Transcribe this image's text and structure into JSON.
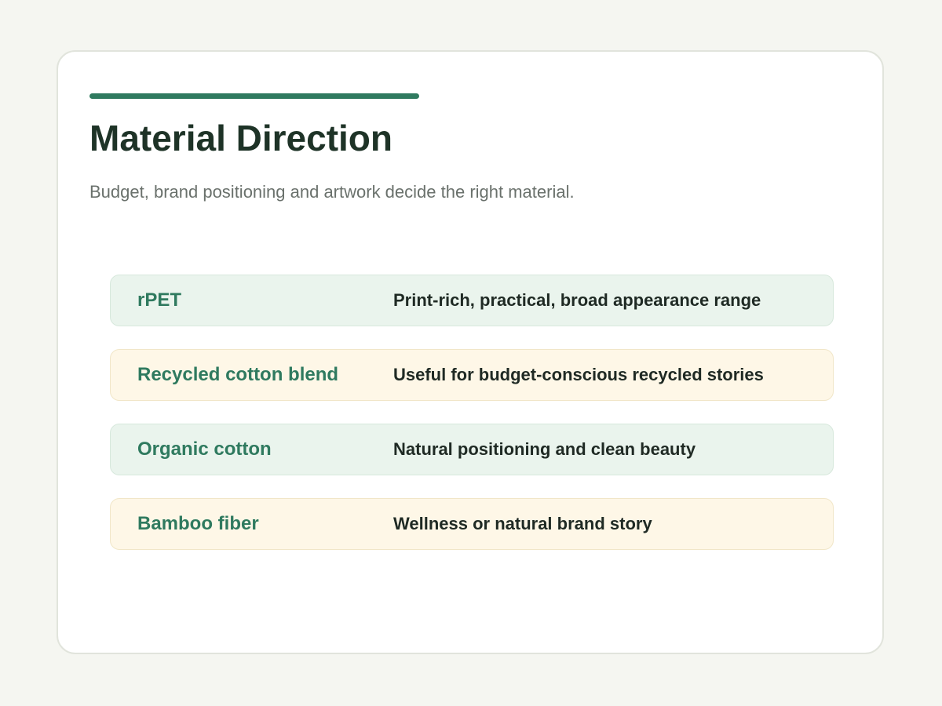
{
  "header": {
    "title": "Material Direction",
    "subtitle": "Budget, brand positioning and artwork decide the right material."
  },
  "materials": [
    {
      "name": "rPET",
      "description": "Print-rich, practical, broad appearance range",
      "tone": "green"
    },
    {
      "name": "Recycled cotton blend",
      "description": "Useful for budget-conscious recycled stories",
      "tone": "cream"
    },
    {
      "name": "Organic cotton",
      "description": "Natural positioning and clean beauty",
      "tone": "green"
    },
    {
      "name": "Bamboo fiber",
      "description": "Wellness or natural brand story",
      "tone": "cream"
    }
  ],
  "colors": {
    "accent": "#2f7a5f",
    "title": "#1e3327",
    "green_row_bg": "#eaf4ed",
    "cream_row_bg": "#fef7e7"
  }
}
